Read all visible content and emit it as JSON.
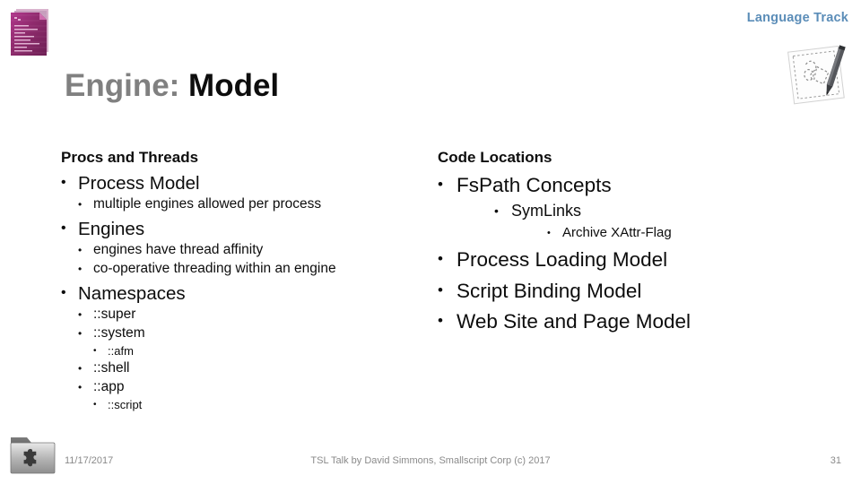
{
  "header": {
    "track_label": "Language Track",
    "title_part1": "Engine:",
    "title_part2": " Model",
    "title_color_gray": "#808080",
    "title_color_black": "#0d0d0d",
    "track_color": "#5B8DB8",
    "doc_icon": "script-document-icon",
    "notepad_icon": "notepad-pencil-icon"
  },
  "columns": {
    "left": {
      "heading": "Procs and Threads",
      "items": [
        {
          "label": "Process Model",
          "children": [
            {
              "label": "multiple engines allowed per process"
            }
          ]
        },
        {
          "label": "Engines",
          "children": [
            {
              "label": "engines have thread affinity"
            },
            {
              "label": "co-operative threading within an engine"
            }
          ]
        },
        {
          "label": "Namespaces",
          "children": [
            {
              "label": "::super"
            },
            {
              "label": "::system",
              "children": [
                {
                  "label": "::afm"
                }
              ]
            },
            {
              "label": "::shell"
            },
            {
              "label": "::app",
              "children": [
                {
                  "label": "::script"
                }
              ]
            }
          ]
        }
      ]
    },
    "right": {
      "heading": "Code Locations",
      "items": [
        {
          "label": "FsPath Concepts",
          "children": [
            {
              "label": "SymLinks",
              "children": [
                {
                  "label": "Archive XAttr-Flag"
                }
              ]
            }
          ]
        },
        {
          "label": "Process Loading Model"
        },
        {
          "label": "Script Binding Model"
        },
        {
          "label": "Web Site and Page Model"
        }
      ]
    }
  },
  "footer": {
    "date": "11/17/2017",
    "center": "TSL Talk by David Simmons, Smallscript Corp (c) 2017",
    "page_number": "31",
    "folder_icon": "folder-puzzle-icon",
    "text_color": "#8a8a8a"
  },
  "bullet_glyph": "•"
}
